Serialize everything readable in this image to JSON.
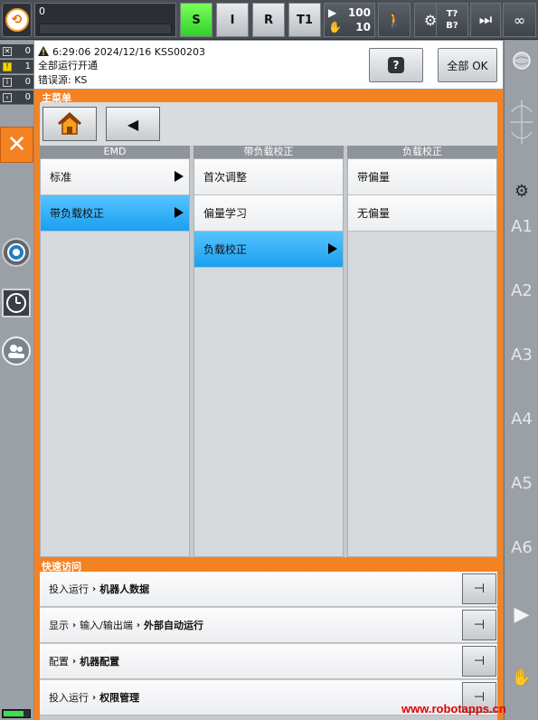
{
  "topbar": {
    "program_progress": "0",
    "modes": [
      {
        "label": "S",
        "active": true
      },
      {
        "label": "I",
        "active": false
      },
      {
        "label": "R",
        "active": false
      },
      {
        "label": "T1",
        "active": false
      }
    ],
    "override_speed": "100",
    "jog_speed": "10",
    "tool_base": {
      "tool": "T?",
      "base": "B?"
    },
    "increment": "∞",
    "icons": [
      "robot-logo-icon",
      "play-icon",
      "jog-hand-icon",
      "walking-man-icon",
      "robot-arm-icon",
      "skip-forward-icon",
      "infinity-icon"
    ]
  },
  "left_strip": {
    "message_counters": [
      {
        "type": "ack",
        "count": "0"
      },
      {
        "type": "warning",
        "count": "1"
      },
      {
        "type": "info",
        "count": "0"
      },
      {
        "type": "dialog",
        "count": "0"
      }
    ]
  },
  "message": {
    "timestamp_line": "6:29:06 2024/12/16 KSS00203",
    "text": "全部运行开通",
    "source": "错误源: KS",
    "help_button": "?",
    "ack_all_button": "全部 OK"
  },
  "main_menu": {
    "title": "主菜单",
    "columns": [
      {
        "header": "EMD",
        "items": [
          {
            "label": "标准",
            "has_submenu": true,
            "selected": false
          },
          {
            "label": "带负载校正",
            "has_submenu": true,
            "selected": true
          }
        ]
      },
      {
        "header": "带负载校正",
        "items": [
          {
            "label": "首次调整",
            "has_submenu": false,
            "selected": false
          },
          {
            "label": "偏量学习",
            "has_submenu": false,
            "selected": false
          },
          {
            "label": "负载校正",
            "has_submenu": true,
            "selected": true
          }
        ]
      },
      {
        "header": "负载校正",
        "items": [
          {
            "label": "带偏量",
            "has_submenu": false,
            "selected": false
          },
          {
            "label": "无偏量",
            "has_submenu": false,
            "selected": false
          }
        ]
      }
    ]
  },
  "quick_access": {
    "title": "快速访问",
    "rows": [
      {
        "path": [
          "投入运行",
          "机器人数据"
        ]
      },
      {
        "path": [
          "显示",
          "输入/输出端",
          "外部自动运行"
        ]
      },
      {
        "path": [
          "配置",
          "机器配置"
        ]
      },
      {
        "path": [
          "投入运行",
          "权限管理"
        ]
      }
    ]
  },
  "right_strip": {
    "axes": [
      "A1",
      "A2",
      "A3",
      "A4",
      "A5",
      "A6"
    ]
  },
  "watermark": "www.robotapps.cn",
  "colors": {
    "accent_orange": "#f58220",
    "selected_blue": "#1aa0f0",
    "active_mode_green": "#2fd12a",
    "warning_yellow": "#f5d400"
  }
}
